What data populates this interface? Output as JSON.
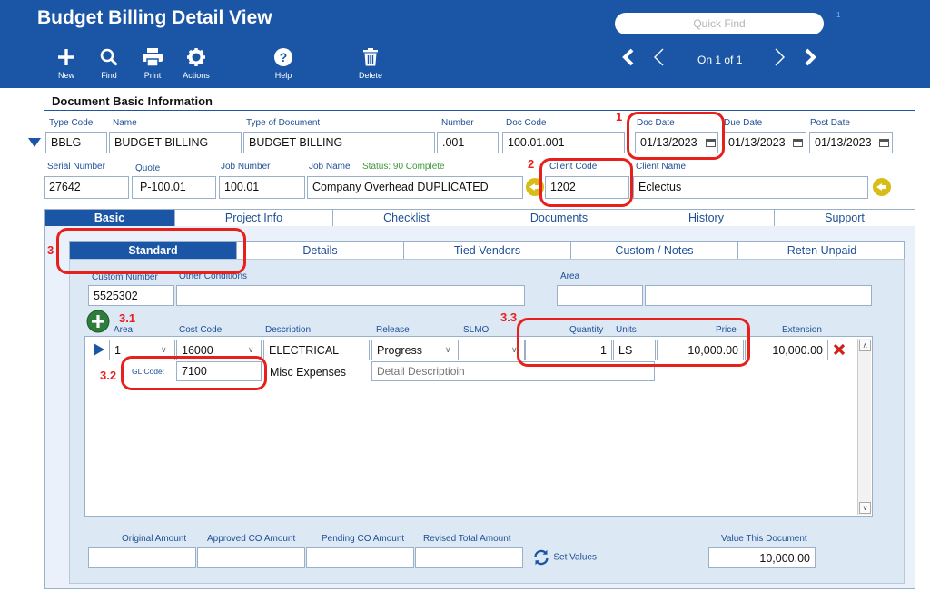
{
  "app": {
    "title": "Budget Billing Detail View"
  },
  "toolbar": {
    "new": "New",
    "find": "Find",
    "print": "Print",
    "actions": "Actions",
    "help": "Help",
    "delete": "Delete"
  },
  "quick_find": {
    "placeholder": "Quick Find",
    "count": "1"
  },
  "record_nav": {
    "position": "On 1 of 1"
  },
  "basic_info": {
    "section_title": "Document Basic Information",
    "type_code": {
      "label": "Type Code",
      "value": "BBLG"
    },
    "name": {
      "label": "Name",
      "value": "BUDGET BILLING"
    },
    "type_of_document": {
      "label": "Type of Document",
      "value": "BUDGET BILLING"
    },
    "number": {
      "label": "Number",
      "value": ".001"
    },
    "doc_code": {
      "label": "Doc Code",
      "value": "100.01.001"
    },
    "doc_date": {
      "label": "Doc Date",
      "value": "01/13/2023"
    },
    "due_date": {
      "label": "Due Date",
      "value": "01/13/2023"
    },
    "post_date": {
      "label": "Post Date",
      "value": "01/13/2023"
    },
    "serial_number": {
      "label": "Serial Number",
      "value": "27642"
    },
    "quote": {
      "label": "Quote",
      "value": "P-100.01"
    },
    "job_number": {
      "label": "Job Number",
      "value": "100.01"
    },
    "job_name": {
      "label": "Job Name",
      "value": "Company Overhead DUPLICATED"
    },
    "status": "Status: 90 Complete",
    "client_code": {
      "label": "Client Code",
      "value": "1202"
    },
    "client_name": {
      "label": "Client Name",
      "value": "Eclectus"
    }
  },
  "main_tabs": [
    "Basic",
    "Project Info",
    "Checklist",
    "Documents",
    "History",
    "Support"
  ],
  "sub_tabs": [
    "Standard",
    "Details",
    "Tied Vendors",
    "Custom / Notes",
    "Reten Unpaid"
  ],
  "standard": {
    "custom_number": {
      "label": "Custom Number",
      "value": "5525302"
    },
    "other_conditions": {
      "label": "Other Conditions",
      "value": ""
    },
    "area": {
      "label": "Area",
      "value": ""
    }
  },
  "grid": {
    "headers": {
      "area": "Area",
      "cost_code": "Cost Code",
      "description": "Description",
      "release": "Release",
      "slmo": "SLMO",
      "quantity": "Quantity",
      "units": "Units",
      "price": "Price",
      "extension": "Extension"
    },
    "rows": [
      {
        "area": "1",
        "cost_code": "16000",
        "description": "ELECTRICAL",
        "release": "Progress",
        "slmo": "",
        "quantity": "1",
        "units": "LS",
        "price": "10,000.00",
        "extension": "10,000.00",
        "gl_label": "GL Code:",
        "gl_code": "7100",
        "gl_desc": "Misc Expenses",
        "detail_placeholder": "Detail Descriptioin"
      }
    ]
  },
  "totals": {
    "original_amount": {
      "label": "Original Amount",
      "value": ""
    },
    "approved_co": {
      "label": "Approved CO Amount",
      "value": ""
    },
    "pending_co": {
      "label": "Pending CO Amount",
      "value": ""
    },
    "revised_total": {
      "label": "Revised Total Amount",
      "value": ""
    },
    "set_values": "Set Values",
    "value_this_document": {
      "label": "Value This Document",
      "value": "10,000.00"
    }
  },
  "callouts": [
    "1",
    "2",
    "3",
    "3.1",
    "3.2",
    "3.3"
  ],
  "colors": {
    "header": "#1b56a6",
    "callout": "#e8201c",
    "gold": "#d8bd16",
    "add_button": "#2e7d3c"
  }
}
